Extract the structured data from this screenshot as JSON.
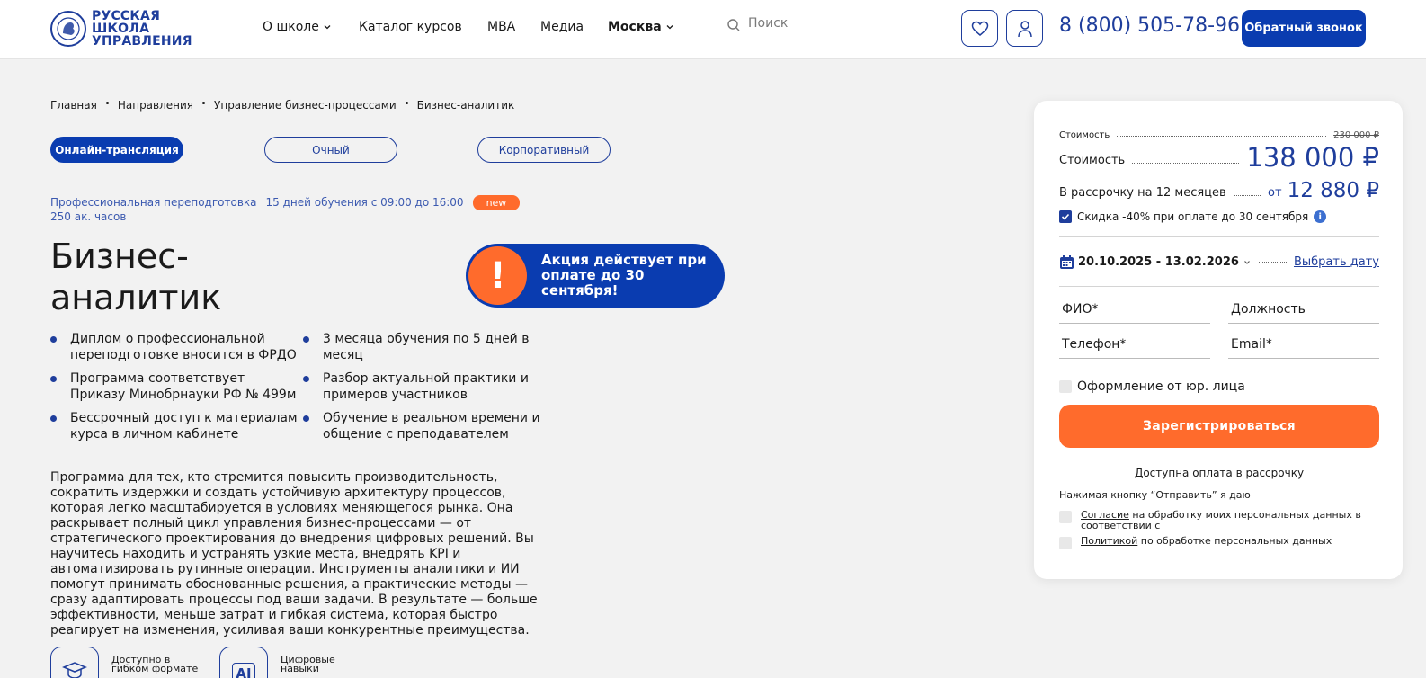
{
  "header": {
    "logo_text": "РУССКАЯ ШКОЛА УПРАВЛЕНИЯ",
    "nav": [
      "О школе",
      "Каталог курсов",
      "MBA",
      "Медиа",
      "Москва"
    ],
    "search_placeholder": "Поиск",
    "phone": "8 (800) 505-78-96",
    "callback_label": "Обратный звонок"
  },
  "breadcrumb": [
    "Главная",
    "Направления",
    "Управление бизнес-процессами",
    "Бизнес-аналитик"
  ],
  "format_tabs": [
    "Онлайн-трансляция",
    "Очный",
    "Корпоративный"
  ],
  "meta": {
    "program_type": "Профессиональная переподготовка",
    "schedule": "15 дней обучения с 09:00 до 16:00",
    "badge": "new",
    "hours": "250 ак. часов"
  },
  "title": "Бизнес-аналитик",
  "promo": {
    "icon": "!",
    "text": "Акция действует при оплате до 30 сентября!"
  },
  "features": [
    "Диплом о профессиональной переподготовке вносится в ФРДО",
    "3 месяца обучения по 5 дней в месяц",
    "Программа соответствует Приказу Минобрнауки РФ № 499м",
    "Разбор актуальной практики и примеров участников",
    "Бессрочный доступ к материалам курса в личном кабинете",
    "Обучение в реальном времени и общение с преподавателем"
  ],
  "description": "Программа для тех, кто стремится повысить производительность, сократить издержки и создать устойчивую архитектуру процессов, которая легко масштабируется в условиях меняющегося рынка. Она раскрывает полный цикл управления бизнес-процессами — от стратегического проектирования до внедрения цифровых решений. Вы научитесь находить и устранять узкие места, внедрять KPI и автоматизировать рутинные операции. Инструменты аналитики и ИИ помогут принимать обоснованные решения, а практические методы — сразу адаптировать процессы под ваши задачи. В результате — больше эффективности, меньше затрат и гибкая система, которая быстро реагирует на изменения, усиливая ваши конкурентные преимущества.",
  "bottom_items": [
    {
      "label": "Доступно в гибком формате",
      "icon": "graduation-cap-icon"
    },
    {
      "label": "Цифровые навыки",
      "icon": "ai-icon",
      "glyph": "AI"
    }
  ],
  "card": {
    "old_price_label": "Стоимость",
    "old_price": "230 000 ₽",
    "price_label": "Стоимость",
    "price": "138 000 ₽",
    "installment_label": "В рассрочку на 12 месяцев",
    "installment_from": "от",
    "installment_price": "12 880 ₽",
    "discount_text": "Скидка -40% при оплате до 30 сентября",
    "discount_checked": true,
    "info_glyph": "i",
    "date_range": "20.10.2025 - 13.02.2026",
    "pick_date": "Выбрать дату",
    "fields": {
      "fio": "ФИО*",
      "position": "Должность",
      "phone": "Телефон*",
      "email": "Email*"
    },
    "legal_entity": "Оформление от юр. лица",
    "register_button": "Зарегистрироваться",
    "installment_note": "Доступна оплата в рассрочку",
    "consent_note": "Нажимая кнопку “Отправить” я даю",
    "consent_1_link": "Согласие",
    "consent_1_text": " на обработку моих персональных данных в соответствии с",
    "consent_2_link": "Политикой",
    "consent_2_text": " по обработке персональных данных"
  },
  "colors": {
    "brand_blue": "#0a3cb0",
    "accent_orange": "#ff6b2c",
    "background": "#f2f2f2"
  }
}
